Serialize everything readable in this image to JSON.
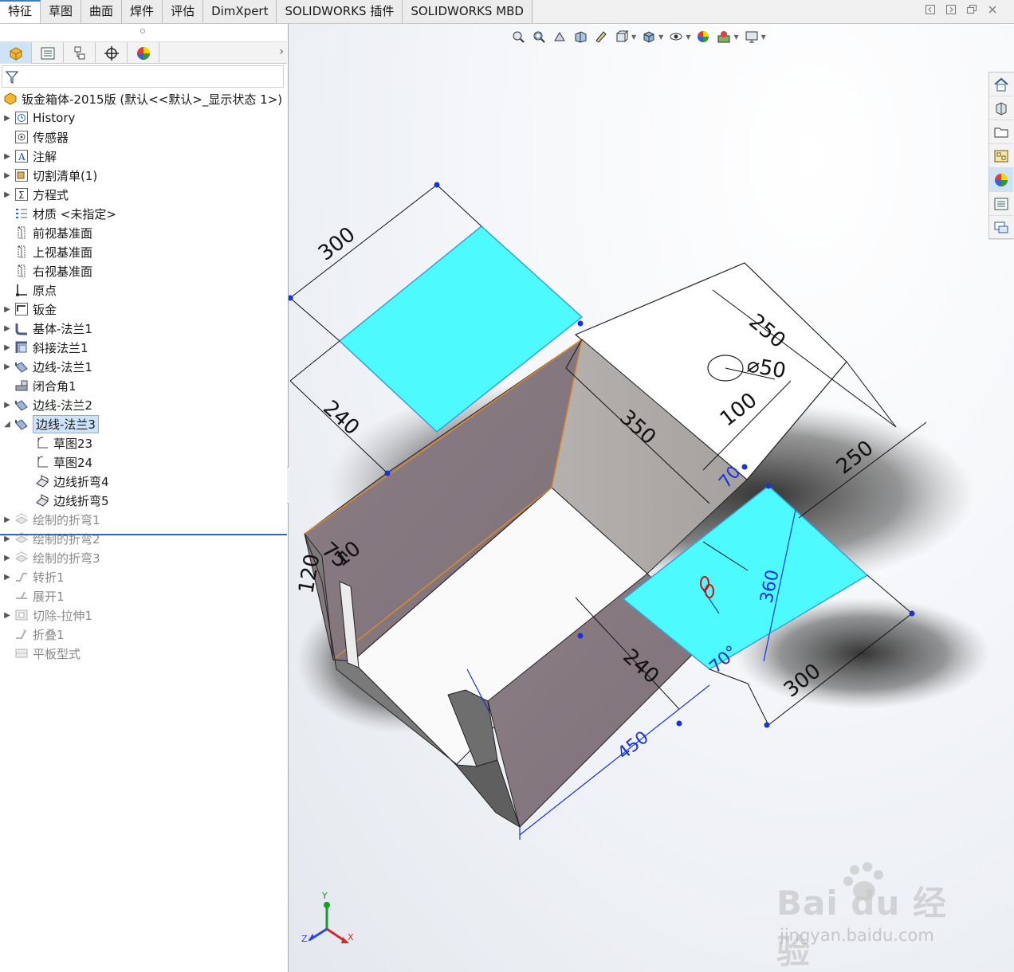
{
  "tabs": [
    {
      "label": "特征",
      "active": true
    },
    {
      "label": "草图"
    },
    {
      "label": "曲面"
    },
    {
      "label": "焊件"
    },
    {
      "label": "评估"
    },
    {
      "label": "DimXpert"
    },
    {
      "label": "SOLIDWORKS 插件"
    },
    {
      "label": "SOLIDWORKS MBD"
    }
  ],
  "tree": {
    "root": "钣金箱体-2015版  (默认<<默认>_显示状态 1>)",
    "items": [
      {
        "label": "History"
      },
      {
        "label": "传感器"
      },
      {
        "label": "注解"
      },
      {
        "label": "切割清单(1)"
      },
      {
        "label": "方程式"
      },
      {
        "label": "材质 <未指定>"
      },
      {
        "label": "前视基准面"
      },
      {
        "label": "上视基准面"
      },
      {
        "label": "右视基准面"
      },
      {
        "label": "原点"
      },
      {
        "label": "钣金"
      },
      {
        "label": "基体-法兰1"
      },
      {
        "label": "斜接法兰1"
      },
      {
        "label": "边线-法兰1"
      },
      {
        "label": "闭合角1"
      },
      {
        "label": "边线-法兰2"
      },
      {
        "label": "边线-法兰3"
      },
      {
        "label": "草图23"
      },
      {
        "label": "草图24"
      },
      {
        "label": "边线折弯4"
      },
      {
        "label": "边线折弯5"
      },
      {
        "label": "绘制的折弯1"
      },
      {
        "label": "绘制的折弯2"
      },
      {
        "label": "绘制的折弯3"
      },
      {
        "label": "转折1"
      },
      {
        "label": "展开1"
      },
      {
        "label": "切除-拉伸1"
      },
      {
        "label": "折叠1"
      },
      {
        "label": "平板型式"
      }
    ]
  },
  "dimensions": {
    "d300_top": "300",
    "d240_left": "240",
    "d250_top": "250",
    "d50_dia": "⌀50",
    "d100": "100",
    "d350": "350",
    "d250_right": "250",
    "d70_top": "70",
    "d360": "360",
    "d70_bottom": "70°",
    "d300_bottom": "300",
    "d240_bottom": "240",
    "d450": "450",
    "d10": "10",
    "d75": "75",
    "d120": "120"
  },
  "triad": {
    "x": "X",
    "y": "Y",
    "z": "Z"
  },
  "watermark": {
    "brand": "Bai du 经验",
    "url": "jingyan.baidu.com"
  },
  "colors": {
    "accent": "#3c7fc2",
    "selection_face": "#4dfbff",
    "wall_face": "#8b7d84",
    "dim_blue": "#1a33d6"
  }
}
